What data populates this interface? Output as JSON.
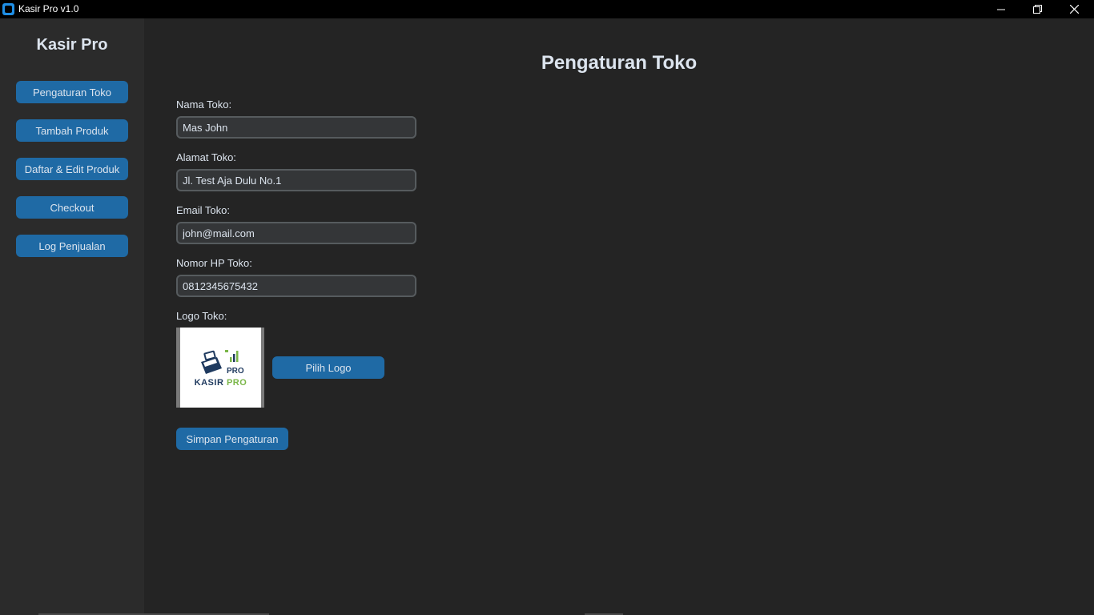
{
  "window": {
    "title": "Kasir Pro v1.0",
    "controls": [
      "minimize",
      "restore",
      "close"
    ]
  },
  "sidebar": {
    "title": "Kasir Pro",
    "items": [
      {
        "label": "Pengaturan Toko"
      },
      {
        "label": "Tambah Produk"
      },
      {
        "label": "Daftar & Edit Produk"
      },
      {
        "label": "Checkout"
      },
      {
        "label": "Log Penjualan"
      }
    ]
  },
  "main": {
    "title": "Pengaturan Toko",
    "fields": [
      {
        "label": "Nama Toko:",
        "value": "Mas John"
      },
      {
        "label": "Alamat Toko:",
        "value": "Jl. Test Aja Dulu No.1"
      },
      {
        "label": "Email Toko:",
        "value": "john@mail.com"
      },
      {
        "label": "Nomor HP Toko:",
        "value": "0812345675432"
      }
    ],
    "logo": {
      "label": "Logo Toko:",
      "image_badge": "PRO",
      "image_word_1": "KASIR",
      "image_word_2": "PRO",
      "choose_label": "Pilih Logo"
    },
    "save_label": "Simpan Pengaturan"
  },
  "colors": {
    "accent": "#1f6aa5",
    "sidebar_bg": "#2b2b2b",
    "main_bg": "#242424",
    "input_bg": "#343638",
    "input_border": "#565b5e",
    "text": "#dce4ee",
    "logo_green": "#7ab648"
  }
}
